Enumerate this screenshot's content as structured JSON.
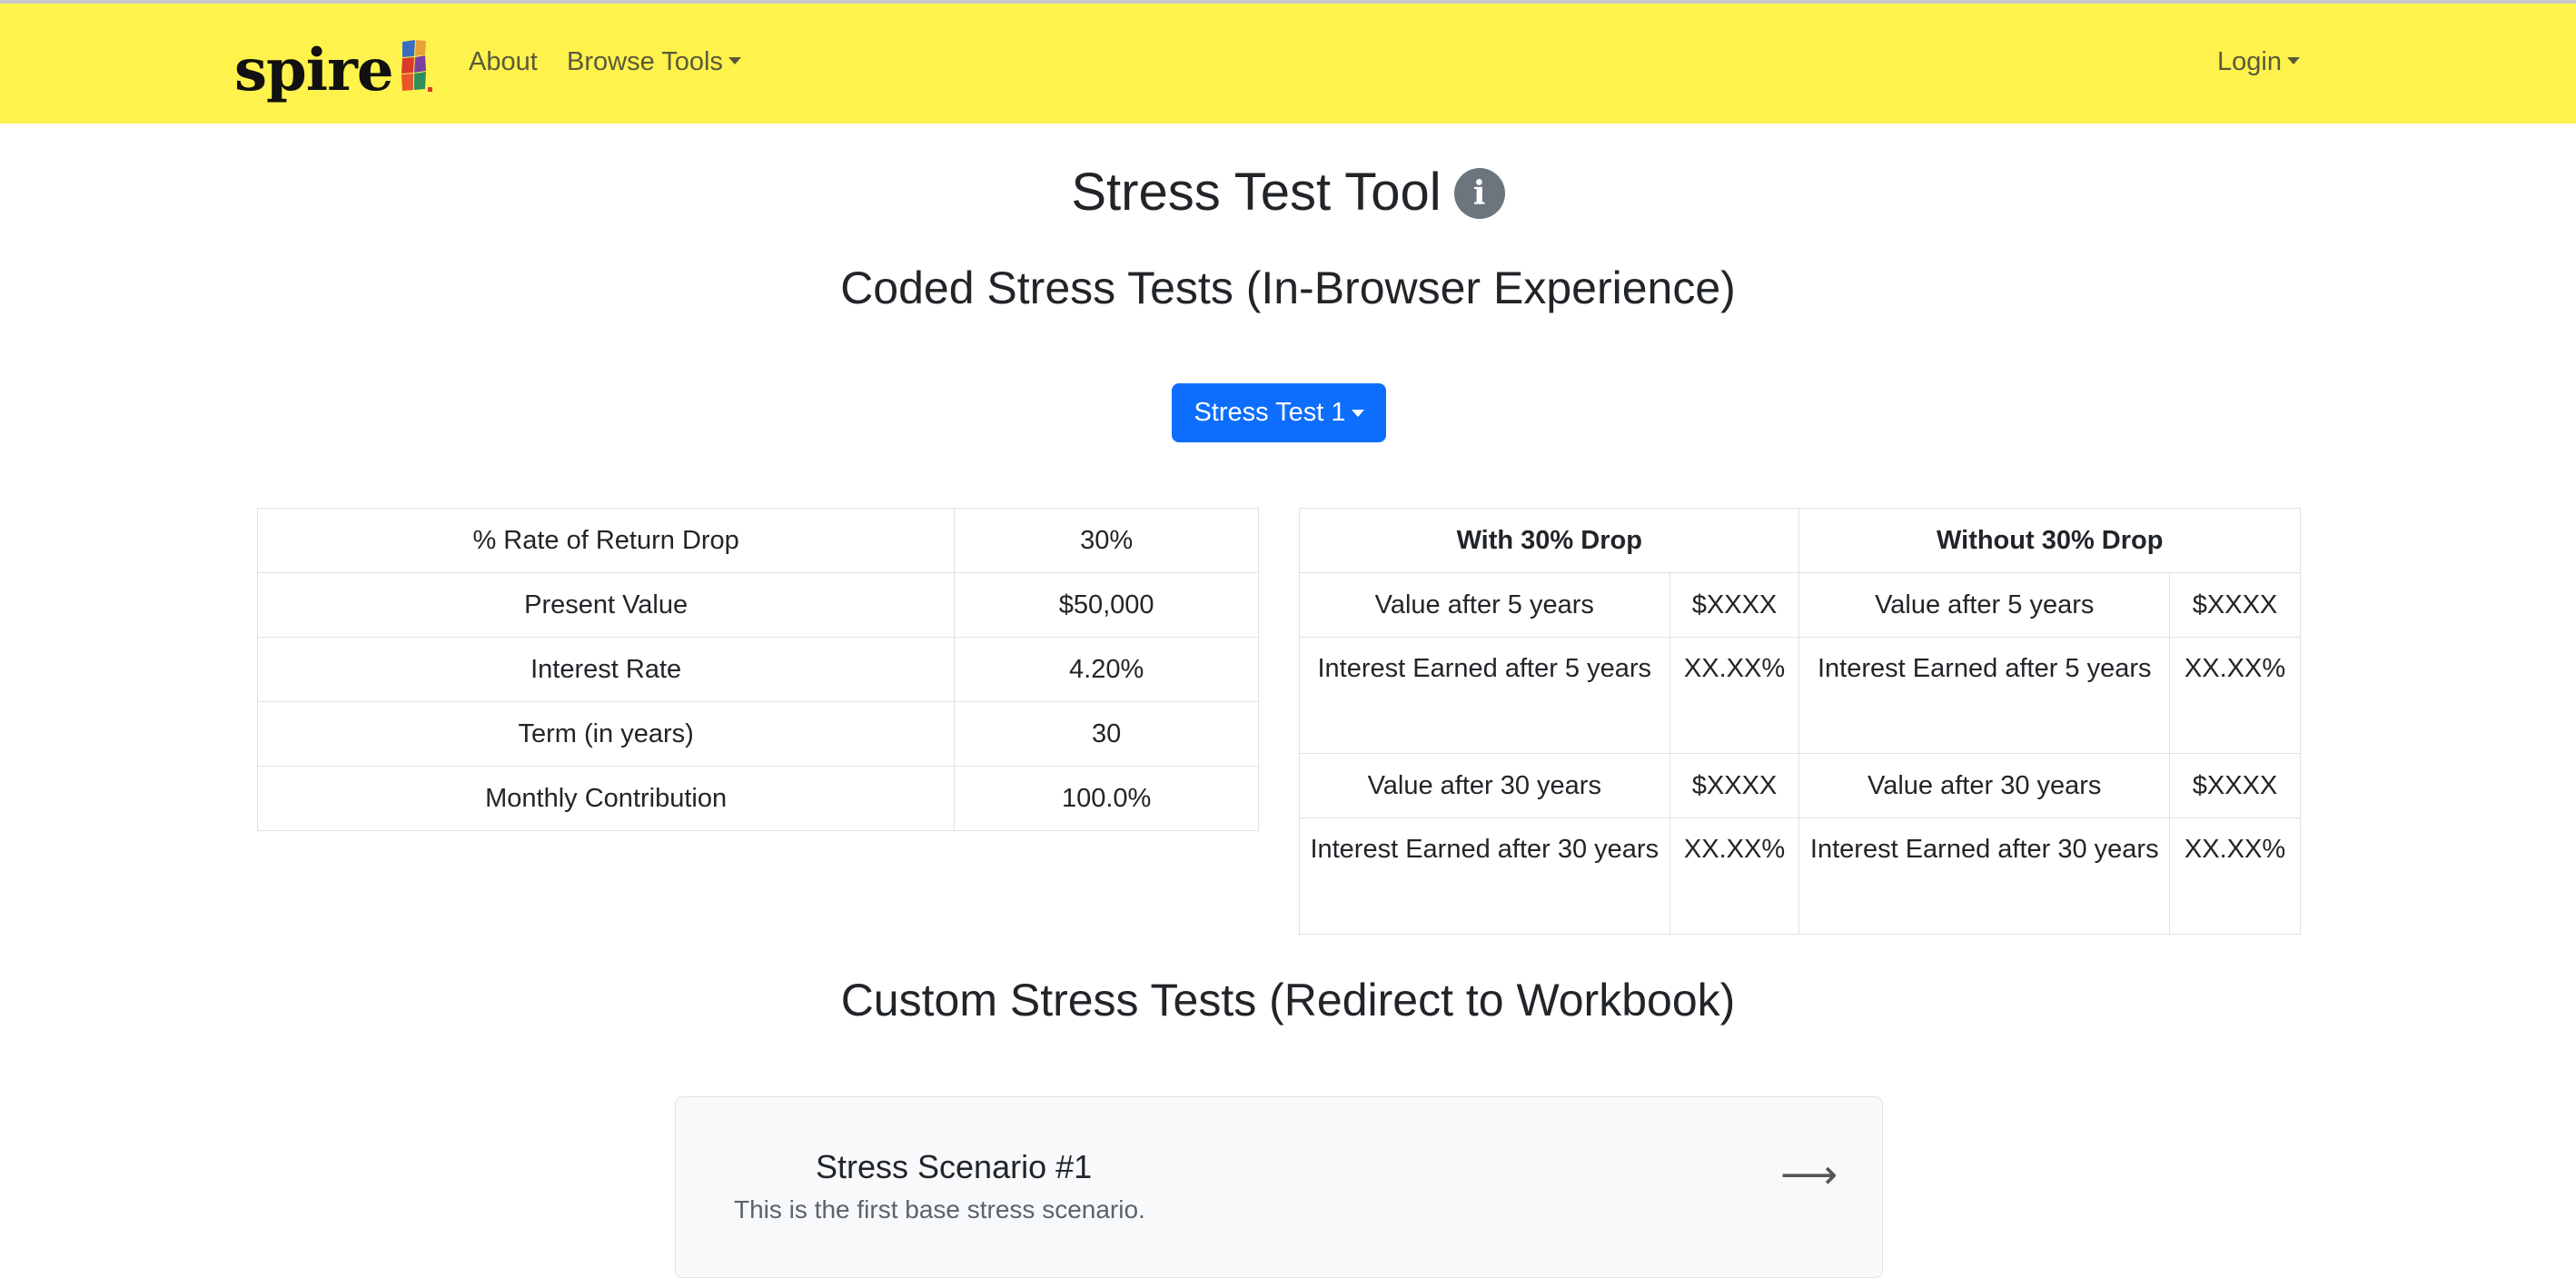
{
  "nav": {
    "logo_text": "spire",
    "about": "About",
    "browse_tools": "Browse Tools",
    "login": "Login"
  },
  "page": {
    "title": "Stress Test Tool",
    "info_icon": "info-icon",
    "coded_heading": "Coded Stress Tests (In-Browser Experience)",
    "dropdown_label": "Stress Test 1",
    "custom_heading": "Custom Stress Tests (Redirect to Workbook)"
  },
  "inputs_table": {
    "rows": [
      {
        "label": "% Rate of Return Drop",
        "value": "30%"
      },
      {
        "label": "Present Value",
        "value": "$50,000"
      },
      {
        "label": "Interest Rate",
        "value": "4.20%"
      },
      {
        "label": "Term (in years)",
        "value": "30"
      },
      {
        "label": "Monthly Contribution",
        "value": "100.0%"
      }
    ]
  },
  "results_table": {
    "headers": [
      "With 30% Drop",
      "Without 30% Drop"
    ],
    "rows": [
      {
        "with_label": "Value after 5 years",
        "with_value": "$XXXX",
        "without_label": "Value after 5 years",
        "without_value": "$XXXX"
      },
      {
        "with_label": "Interest Earned after 5 years",
        "with_value": "XX.XX%",
        "without_label": "Interest Earned after 5 years",
        "without_value": "XX.XX%"
      },
      {
        "with_label": "Value after 30 years",
        "with_value": "$XXXX",
        "without_label": "Value after 30 years",
        "without_value": "$XXXX"
      },
      {
        "with_label": "Interest Earned after 30 years",
        "with_value": "XX.XX%",
        "without_label": "Interest Earned after 30 years",
        "without_value": "XX.XX%"
      }
    ]
  },
  "scenario_card": {
    "title": "Stress Scenario #1",
    "description": "This is the first base stress scenario.",
    "arrow": "⟶"
  },
  "colors": {
    "navbar": "#fff24d",
    "primary_button": "#0d6efd",
    "info_icon": "#6c757d"
  }
}
